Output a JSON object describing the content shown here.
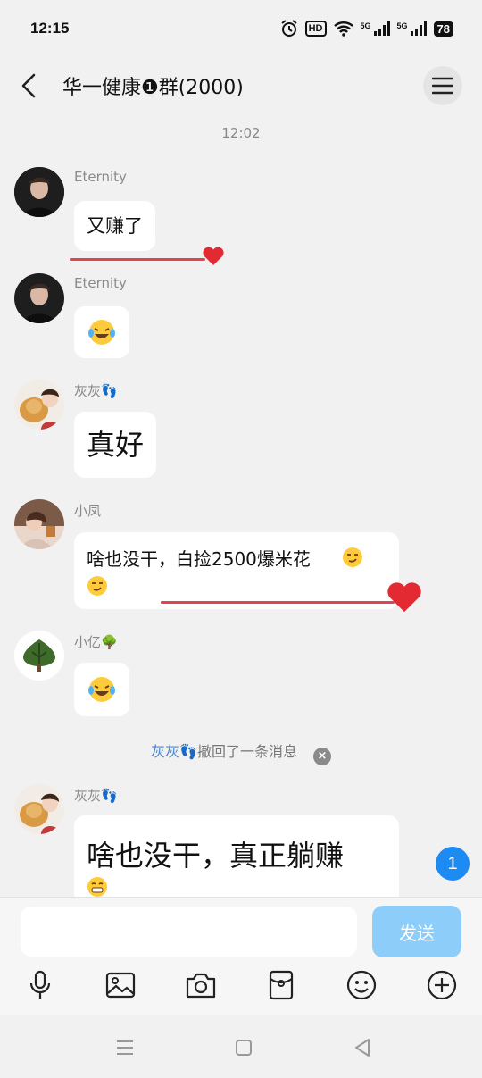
{
  "status_bar": {
    "time": "12:15",
    "hd_label": "HD",
    "hd_sub": "1 2",
    "signal_1": "5G",
    "signal_2": "5G",
    "battery": "78"
  },
  "header": {
    "title": "华一健康❶群(2000)"
  },
  "timestamp": "12:02",
  "messages": [
    {
      "sender": "Eternity",
      "text": "又赚了"
    },
    {
      "sender": "Eternity",
      "emoji": "laughing-tears-emoji"
    },
    {
      "sender": "灰灰👣",
      "text": "真好"
    },
    {
      "sender": "小凤",
      "text_line1": "啥也没干，白捡2500爆米花",
      "emoji": "smirk-emoji"
    },
    {
      "sender": "小亿🌳",
      "emoji": "laughing-tears-emoji"
    },
    {
      "sender": "灰灰👣",
      "text": "啥也没干，真正躺赚",
      "emoji": "grin-emoji"
    }
  ],
  "recall": {
    "name": "灰灰👣",
    "text": "撤回了一条消息"
  },
  "unread_count": "1",
  "input": {
    "placeholder": "",
    "send_label": "发送"
  },
  "toolbar": [
    "mic-icon",
    "image-icon",
    "camera-icon",
    "red-packet-icon",
    "emoji-icon",
    "plus-icon"
  ],
  "colors": {
    "accent": "#1e8bf2",
    "send_button": "#8ccdfa",
    "underline": "#e0454d",
    "recall_name": "#4a8ad8"
  }
}
